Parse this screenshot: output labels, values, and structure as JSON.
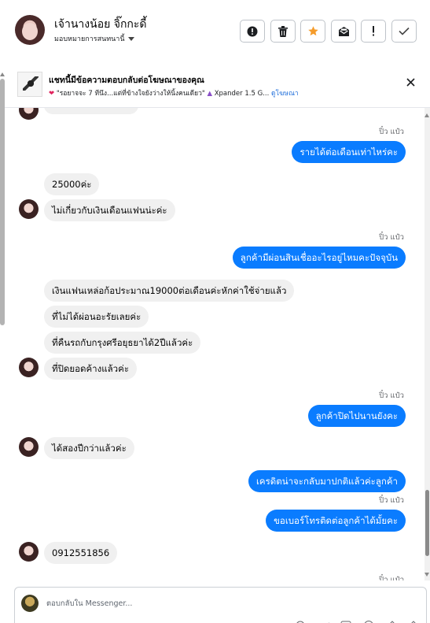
{
  "header": {
    "contact_name": "เจ้านางน้อย จิ๊กกะดี้",
    "assign_label": "มอบหมายการสนทนานี้",
    "buttons": [
      "spam-icon",
      "trash-icon",
      "star-icon",
      "mail-icon",
      "alert-icon",
      "check-icon"
    ],
    "accent": "#f59c2b"
  },
  "ad": {
    "title": "แชทนี้มีข้อความตอบกลับต่อโฆษณาของคุณ",
    "snippet": "\"รอยาจจะ 7 ทีนึง...แต่ที่ข้างใจยังว่างให้นิ้งคนเดียว\"",
    "product": "Xpander 1.5 G...",
    "link_label": "ดูโฆษณา"
  },
  "messages": [
    {
      "id": "m1",
      "sender": "ปิ๋ว แป๋ว",
      "text": "รายได้ต่อเดือนเท่าไหร่คะ"
    },
    {
      "id": "m2",
      "text": "25000ค่ะ"
    },
    {
      "id": "m3",
      "text": "ไม่เกี่ยวกับเงินเดือนแฟนน่ะค่ะ"
    },
    {
      "id": "m4",
      "sender": "ปิ๋ว แป๋ว",
      "text": "ลูกค้ามีผ่อนสินเชื่ออะไรอยู่ไหมคะปัจจุบัน"
    },
    {
      "id": "m5",
      "text": "เงินแฟนเหล่อก้อประมาณ19000ต่อเดือนค่ะหักค่าใช้จ่ายแล้ว"
    },
    {
      "id": "m6",
      "text": "ที่ไม่ได้ผ่อนอะรัยเลยค่ะ"
    },
    {
      "id": "m7",
      "text": "ที่คืนรถกับกรุงศรีอยุธยาได้2ปีแล้วค่ะ"
    },
    {
      "id": "m8",
      "text": "ที่ปิดยอดค้างแล้วค่ะ"
    },
    {
      "id": "m9",
      "sender": "ปิ๋ว แป๋ว",
      "text": "ลูกค้าปิดไปนานยังคะ"
    },
    {
      "id": "m10",
      "text": "ได้สองปีกว่าแล้วค่ะ"
    },
    {
      "id": "m11",
      "text": "เครดิตน่าจะกลับมาปกติแล้วค่ะลูกค้า"
    },
    {
      "id": "m12",
      "sender": "ปิ๋ว แป๋ว",
      "text": "ขอเบอร์โทรติดต่อลูกค้าได้มั้ยคะ"
    },
    {
      "id": "m13",
      "text": "0912551856"
    }
  ],
  "colors": {
    "outgoing_bubble": "#0a7cff",
    "incoming_bubble": "#f0f0f0",
    "link": "#216fdb"
  },
  "composer": {
    "placeholder": "ตอบกลับใน Messenger..."
  }
}
